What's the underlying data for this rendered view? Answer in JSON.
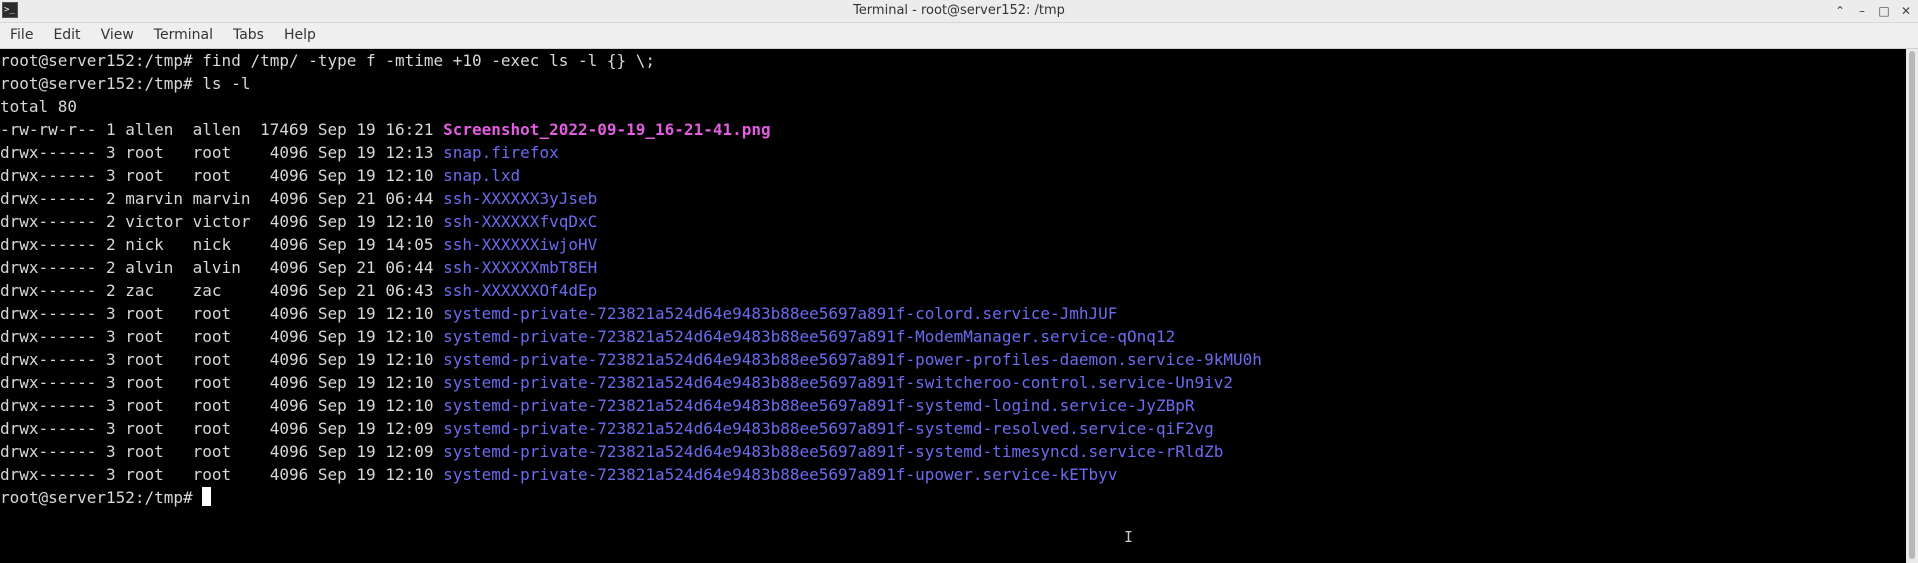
{
  "window": {
    "title": "Terminal - root@server152: /tmp"
  },
  "menu": [
    "File",
    "Edit",
    "View",
    "Terminal",
    "Tabs",
    "Help"
  ],
  "terminal": {
    "commands": [
      "root@server152:/tmp# find /tmp/ -type f -mtime +10 -exec ls -l {} \\;",
      "root@server152:/tmp# ls -l"
    ],
    "total": "total 80",
    "entries": [
      {
        "info": "-rw-rw-r-- 1 allen  allen  17469 Sep 19 16:21 ",
        "name": "Screenshot_2022-09-19_16-21-41.png",
        "kind": "img"
      },
      {
        "info": "drwx------ 3 root   root    4096 Sep 19 12:13 ",
        "name": "snap.firefox",
        "kind": "dir"
      },
      {
        "info": "drwx------ 3 root   root    4096 Sep 19 12:10 ",
        "name": "snap.lxd",
        "kind": "dir"
      },
      {
        "info": "drwx------ 2 marvin marvin  4096 Sep 21 06:44 ",
        "name": "ssh-XXXXXX3yJseb",
        "kind": "dir"
      },
      {
        "info": "drwx------ 2 victor victor  4096 Sep 19 12:10 ",
        "name": "ssh-XXXXXXfvqDxC",
        "kind": "dir"
      },
      {
        "info": "drwx------ 2 nick   nick    4096 Sep 19 14:05 ",
        "name": "ssh-XXXXXXiwjoHV",
        "kind": "dir"
      },
      {
        "info": "drwx------ 2 alvin  alvin   4096 Sep 21 06:44 ",
        "name": "ssh-XXXXXXmbT8EH",
        "kind": "dir"
      },
      {
        "info": "drwx------ 2 zac    zac     4096 Sep 21 06:43 ",
        "name": "ssh-XXXXXXOf4dEp",
        "kind": "dir"
      },
      {
        "info": "drwx------ 3 root   root    4096 Sep 19 12:10 ",
        "name": "systemd-private-723821a524d64e9483b88ee5697a891f-colord.service-JmhJUF",
        "kind": "dir"
      },
      {
        "info": "drwx------ 3 root   root    4096 Sep 19 12:10 ",
        "name": "systemd-private-723821a524d64e9483b88ee5697a891f-ModemManager.service-qOnq12",
        "kind": "dir"
      },
      {
        "info": "drwx------ 3 root   root    4096 Sep 19 12:10 ",
        "name": "systemd-private-723821a524d64e9483b88ee5697a891f-power-profiles-daemon.service-9kMU0h",
        "kind": "dir"
      },
      {
        "info": "drwx------ 3 root   root    4096 Sep 19 12:10 ",
        "name": "systemd-private-723821a524d64e9483b88ee5697a891f-switcheroo-control.service-Un9iv2",
        "kind": "dir"
      },
      {
        "info": "drwx------ 3 root   root    4096 Sep 19 12:10 ",
        "name": "systemd-private-723821a524d64e9483b88ee5697a891f-systemd-logind.service-JyZBpR",
        "kind": "dir"
      },
      {
        "info": "drwx------ 3 root   root    4096 Sep 19 12:09 ",
        "name": "systemd-private-723821a524d64e9483b88ee5697a891f-systemd-resolved.service-qiF2vg",
        "kind": "dir"
      },
      {
        "info": "drwx------ 3 root   root    4096 Sep 19 12:09 ",
        "name": "systemd-private-723821a524d64e9483b88ee5697a891f-systemd-timesyncd.service-rRldZb",
        "kind": "dir"
      },
      {
        "info": "drwx------ 3 root   root    4096 Sep 19 12:10 ",
        "name": "systemd-private-723821a524d64e9483b88ee5697a891f-upower.service-kETbyv",
        "kind": "dir"
      }
    ],
    "prompt": "root@server152:/tmp# "
  },
  "colors": {
    "dir": "#6b6bf0",
    "img": "#e25de0",
    "text": "#d8d8d8",
    "background": "#000000"
  }
}
